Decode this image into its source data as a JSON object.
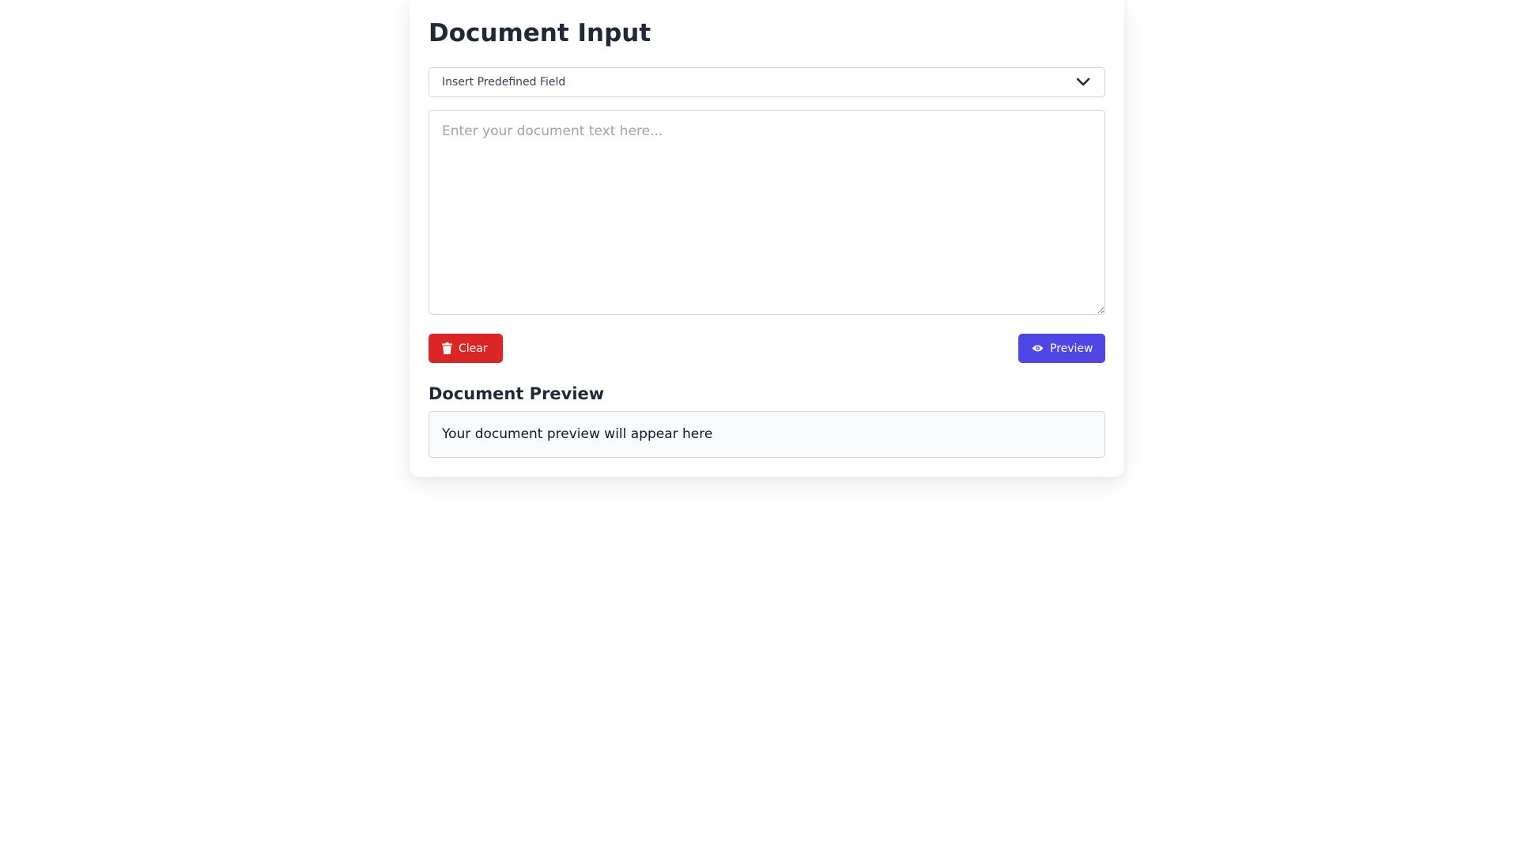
{
  "header": {
    "title": "Document Input"
  },
  "field_select": {
    "selected_label": "Insert Predefined Field",
    "icon": "chevron-down-icon"
  },
  "editor": {
    "value": "",
    "placeholder": "Enter your document text here..."
  },
  "actions": {
    "clear_label": "Clear",
    "clear_icon": "trash-icon",
    "clear_color": "#dc2626",
    "preview_label": "Preview",
    "preview_icon": "eye-icon",
    "preview_color": "#4f46e5"
  },
  "preview": {
    "heading": "Document Preview",
    "content": "Your document preview will appear here"
  }
}
